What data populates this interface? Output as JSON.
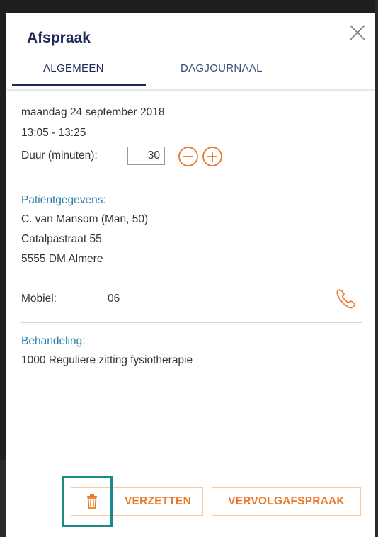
{
  "header": {
    "title": "Afspraak",
    "tabs": [
      {
        "label": "ALGEMEEN",
        "active": true
      },
      {
        "label": "DAGJOURNAAL",
        "active": false
      }
    ],
    "close_icon": "close-icon"
  },
  "appointment": {
    "date": "maandag 24 september 2018",
    "time": "13:05 - 13:25",
    "duration_label": "Duur (minuten):",
    "duration_value": "30"
  },
  "patient": {
    "section_label": "Patiëntgegevens:",
    "name": "C. van Mansom (Man, 50)",
    "street": "Catalpastraat 55",
    "city": "5555 DM Almere",
    "mobile_label": "Mobiel:",
    "mobile_value": "06"
  },
  "treatment": {
    "section_label": "Behandeling:",
    "description": "1000 Reguliere zitting fysiotherapie"
  },
  "actions": {
    "delete_icon": "trash-icon",
    "move_label": "VERZETTEN",
    "followup_label": "VERVOLGAFSPRAAK"
  },
  "colors": {
    "navy": "#1f2a5a",
    "accent_orange": "#e8792b",
    "label_blue": "#2d7ea8",
    "highlight_teal": "#1a8a8a"
  }
}
